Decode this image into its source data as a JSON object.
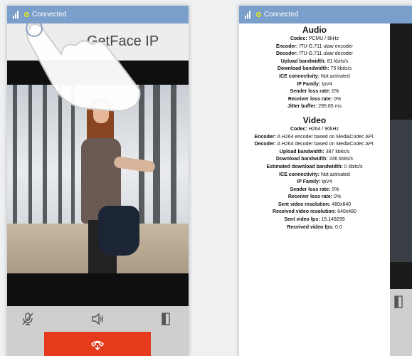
{
  "left_phone": {
    "status": {
      "text": "Connected",
      "signal_icon": "signal-bars-icon"
    },
    "app_title": "GetFace IP",
    "controls": {
      "mute": "mic-off-icon",
      "speaker": "speaker-icon",
      "door": "door-icon"
    },
    "end_call_icon": "hang-up-icon"
  },
  "right_phone": {
    "status": {
      "text": "Connected"
    },
    "audio": {
      "heading": "Audio",
      "rows": [
        {
          "k": "Codec:",
          "v": "PCMU / 8kHz"
        },
        {
          "k": "Encoder:",
          "v": "ITU-G.711 ulaw encoder"
        },
        {
          "k": "Decoder:",
          "v": "ITU-G.711 ulaw decoder"
        },
        {
          "k": "Upload bandwidth:",
          "v": "81 kbits/s"
        },
        {
          "k": "Download bandwidth:",
          "v": "75 kbits/s"
        },
        {
          "k": "ICE connectivity:",
          "v": "Not activated"
        },
        {
          "k": "IP Family:",
          "v": "IpV4"
        },
        {
          "k": "Sender loss rate:",
          "v": "0%"
        },
        {
          "k": "Receiver loss rate:",
          "v": "0%"
        },
        {
          "k": "Jitter buffer:",
          "v": "295.85 ms"
        }
      ]
    },
    "video": {
      "heading": "Video",
      "rows": [
        {
          "k": "Codec:",
          "v": "H264 / 90kHz"
        },
        {
          "k": "Encoder:",
          "v": "A H264 encoder based on MediaCodec API."
        },
        {
          "k": "Decoder:",
          "v": "A H264 decoder based on MediaCodec API."
        },
        {
          "k": "Upload bandwidth:",
          "v": "387 kbits/s"
        },
        {
          "k": "Download bandwidth:",
          "v": "246 kbits/s"
        },
        {
          "k": "Estimated download bandwidth:",
          "v": "0 kbits/s"
        },
        {
          "k": "ICE connectivity:",
          "v": "Not activated"
        },
        {
          "k": "IP Family:",
          "v": "IpV4"
        },
        {
          "k": "Sender loss rate:",
          "v": "0%"
        },
        {
          "k": "Receiver loss rate:",
          "v": "0%"
        },
        {
          "k": "Sent video resolution:",
          "v": "480x640"
        },
        {
          "k": "Received video resolution:",
          "v": "640x480"
        },
        {
          "k": "Sent video fps:",
          "v": "15.149299"
        },
        {
          "k": "Received video fps:",
          "v": "0.0"
        }
      ]
    }
  },
  "colors": {
    "status_bar": "#7a9fca",
    "end_call": "#e53a1c",
    "status_dot": "#e0e61f"
  }
}
